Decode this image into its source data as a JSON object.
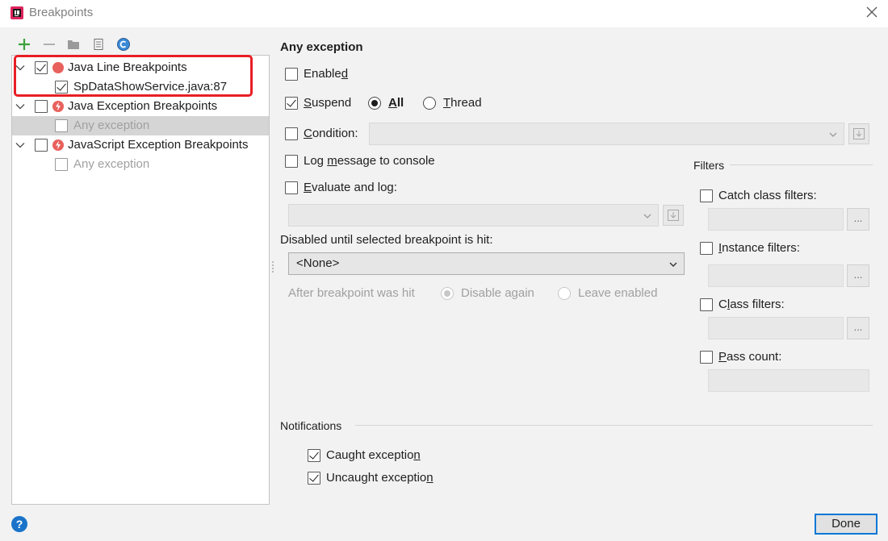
{
  "window": {
    "title": "Breakpoints"
  },
  "tree": {
    "groups": [
      {
        "label": "Java Line Breakpoints",
        "checked": true,
        "items": [
          {
            "label": "SpDataShowService.java:87",
            "checked": true
          }
        ]
      },
      {
        "label": "Java Exception Breakpoints",
        "checked": false,
        "items": [
          {
            "label": "Any exception",
            "checked": false,
            "selected": true
          }
        ]
      },
      {
        "label": "JavaScript Exception Breakpoints",
        "checked": false,
        "items": [
          {
            "label": "Any exception",
            "checked": false
          }
        ]
      }
    ]
  },
  "details": {
    "heading": "Any exception",
    "enabled": {
      "pre": "Enable",
      "u": "d",
      "post": "",
      "checked": false
    },
    "suspend": {
      "u": "S",
      "post": "uspend",
      "checked": true
    },
    "suspend_all": {
      "u": "A",
      "post": "ll",
      "selected": true
    },
    "suspend_thread": {
      "u": "T",
      "post": "hread",
      "selected": false
    },
    "condition": {
      "u": "C",
      "post": "ondition:",
      "checked": false
    },
    "log_message": {
      "pre": "Log ",
      "u": "m",
      "post": "essage to console",
      "checked": false
    },
    "evaluate": {
      "u": "E",
      "post": "valuate and log:",
      "checked": false
    },
    "disabled_until_label": "Disabled until selected breakpoint is hit:",
    "disabled_until_value": "<None>",
    "after_hit_label": "After breakpoint was hit",
    "disable_again": "Disable again",
    "leave_enabled": "Leave enabled"
  },
  "filters": {
    "heading": "Filters",
    "catch_class": {
      "pre": "Catch class filters:",
      "checked": false
    },
    "instance": {
      "u": "I",
      "post": "nstance filters:",
      "checked": false
    },
    "class": {
      "pre": "C",
      "u": "l",
      "post": "ass filters:",
      "checked": false
    },
    "pass_count": {
      "u": "P",
      "post": "ass count:",
      "checked": false
    },
    "dots": "..."
  },
  "notifications": {
    "heading": "Notifications",
    "caught": {
      "pre": "Caught exceptio",
      "u": "n",
      "post": "",
      "checked": true
    },
    "uncaught": {
      "pre": "Uncaught exceptio",
      "u": "n",
      "post": "",
      "checked": true
    }
  },
  "footer": {
    "help": "?",
    "done": "Done"
  },
  "colors": {
    "accent": "#0078d7",
    "breakpoint_red": "#e8615d",
    "add_green": "#3aa23a",
    "highlight_red": "#e81e25"
  }
}
